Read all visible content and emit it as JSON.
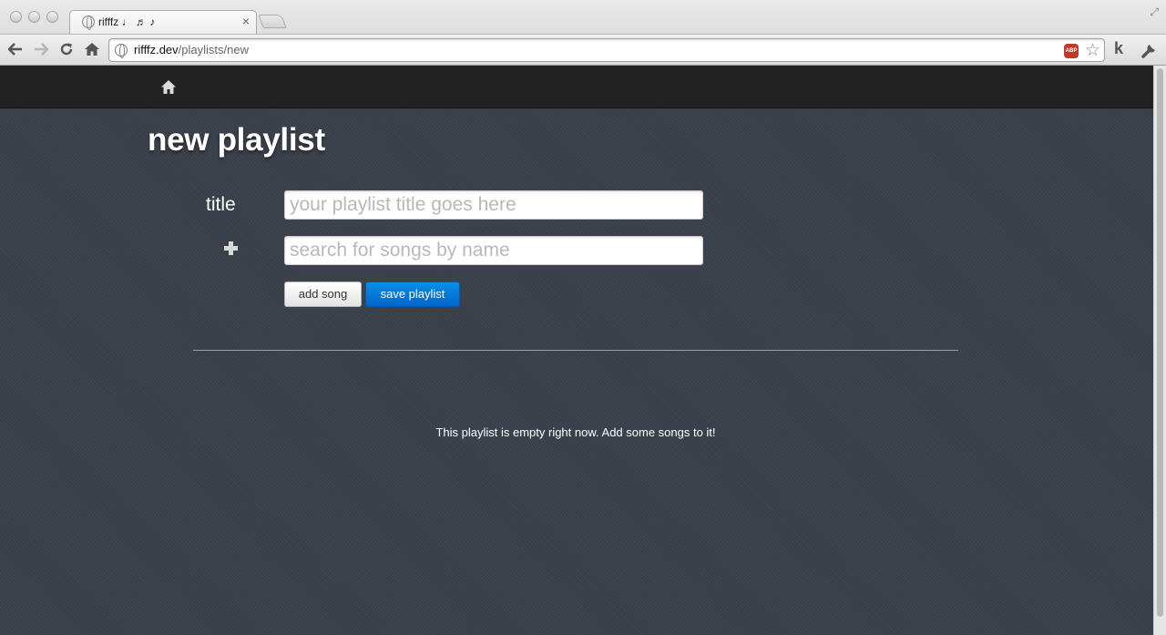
{
  "browser": {
    "tab_title": "rifffz ♩ ♬ ♪",
    "url_host": "rifffz.dev",
    "url_path": "/playlists/new",
    "abp_label": "ABP",
    "ext_k_label": "k"
  },
  "page": {
    "title": "new playlist",
    "form": {
      "title_label": "title",
      "title_placeholder": "your playlist title goes here",
      "title_value": "",
      "search_placeholder": "search for songs by name",
      "search_value": "",
      "add_song_label": "add song",
      "save_playlist_label": "save playlist"
    },
    "empty_message": "This playlist is empty right now. Add some songs to it!"
  },
  "colors": {
    "page_background": "#3b414b",
    "navbar": "#222222",
    "primary_button": "#0077dd",
    "text": "#ffffff"
  },
  "icons": {
    "navbar": "home-icon",
    "search_row": "plus-icon",
    "address_bar": [
      "page-globe-icon",
      "adblock-icon",
      "star-icon"
    ],
    "toolbar": [
      "back-arrow-icon",
      "forward-arrow-icon",
      "reload-icon",
      "browser-home-icon",
      "wrench-icon"
    ]
  }
}
